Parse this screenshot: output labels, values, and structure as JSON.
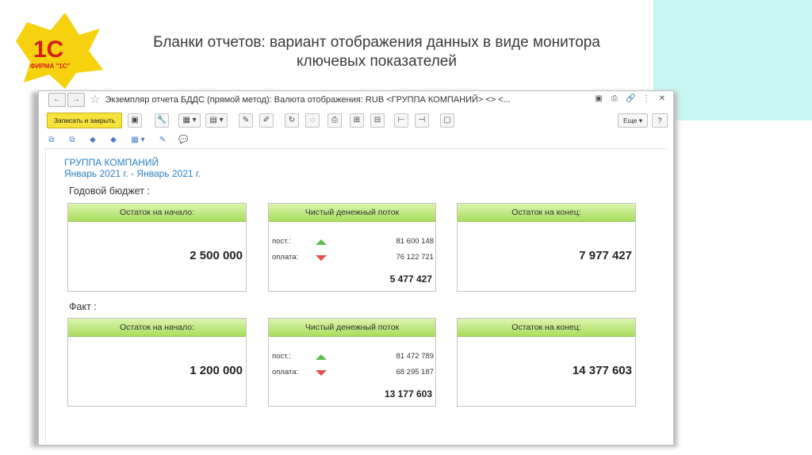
{
  "slide": {
    "title_line1": "Бланки отчетов: вариант отображения данных в виде монитора",
    "title_line2": "ключевых показателей",
    "logo_brand": "1С",
    "logo_text": "ФИРМА \"1С\""
  },
  "window": {
    "title": "Экземпляр отчета БДДС (прямой метод):  Валюта отображения:  RUB <ГРУППА КОМПАНИЙ> <> <...",
    "nav_back": "←",
    "nav_forward": "→",
    "star": "☆",
    "icons": [
      "save-icon",
      "print-icon",
      "link-icon",
      "more-icon",
      "close-icon"
    ],
    "icon_glyphs": [
      "▣",
      "⎙",
      "🔗",
      "⋮",
      "✕"
    ]
  },
  "toolbar": {
    "save_close": "Записать и закрыть",
    "buttons": [
      "▣",
      "🔧",
      "▦ ▾",
      "▤ ▾",
      "✎",
      "✐",
      "↻",
      "◌",
      "⎙",
      "⊞",
      "⊟",
      "⊢",
      "⊣",
      "▢"
    ],
    "more": "Еще ▾",
    "help": "?"
  },
  "toolbar2": [
    "⧉",
    "⧉",
    "◆",
    "◆",
    "▦ ▾",
    "✎",
    "💬"
  ],
  "report": {
    "company": "ГРУППА КОМПАНИЙ",
    "period": "Январь 2021 г. - Январь 2021 г.",
    "sections": [
      {
        "label": "Годовой бюджет :",
        "start_title": "Остаток на начало:",
        "start_value": "2 500 000",
        "flow_title": "Чистый денежный поток",
        "income_label": "пост.:",
        "income_value": "81 600 148",
        "payment_label": "оплата:",
        "payment_value": "76 122 721",
        "flow_total": "5 477 427",
        "end_title": "Остаток на конец:",
        "end_value": "7 977 427"
      },
      {
        "label": "Факт :",
        "start_title": "Остаток на начало:",
        "start_value": "1 200 000",
        "flow_title": "Чистый денежный поток",
        "income_label": "пост.:",
        "income_value": "81 472 789",
        "payment_label": "оплата:",
        "payment_value": "68 295 187",
        "flow_total": "13 177 603",
        "end_title": "Остаток на конец:",
        "end_value": "14 377 603"
      }
    ]
  },
  "colors": {
    "accent_yellow": "#f5e23a",
    "header_green": "#a8dc5c",
    "link_blue": "#2a7fc4",
    "up_green": "#5fbd52",
    "down_red": "#e0524a",
    "teal_block": "#c9f6f1"
  }
}
